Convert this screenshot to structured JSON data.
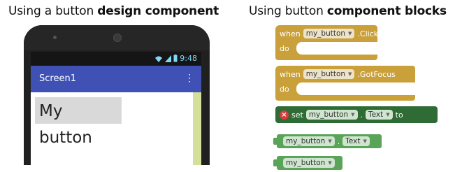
{
  "headings": {
    "left_prefix": "Using a button ",
    "left_bold": "design component",
    "right_prefix": "Using button ",
    "right_bold": "component blocks"
  },
  "phone": {
    "status_time": "9:48",
    "screen_title": "Screen1",
    "overflow_menu": "⋮",
    "button_label": "My button"
  },
  "blocks": {
    "click_event": {
      "when": "when",
      "component": "my_button",
      "event": ".Click",
      "do": "do"
    },
    "focus_event": {
      "when": "when",
      "component": "my_button",
      "event": ".GotFocus",
      "do": "do"
    },
    "setter": {
      "error": "×",
      "set": "set",
      "component": "my_button",
      "dot": ".",
      "property": "Text",
      "to": "to"
    },
    "getter": {
      "component": "my_button",
      "dot": ".",
      "property": "Text"
    },
    "component_block": {
      "component": "my_button"
    }
  },
  "colors": {
    "event_block": "#c9a03a",
    "setter_block": "#2e6b35",
    "getter_block": "#5aa45a",
    "app_bar": "#3f51b5"
  }
}
